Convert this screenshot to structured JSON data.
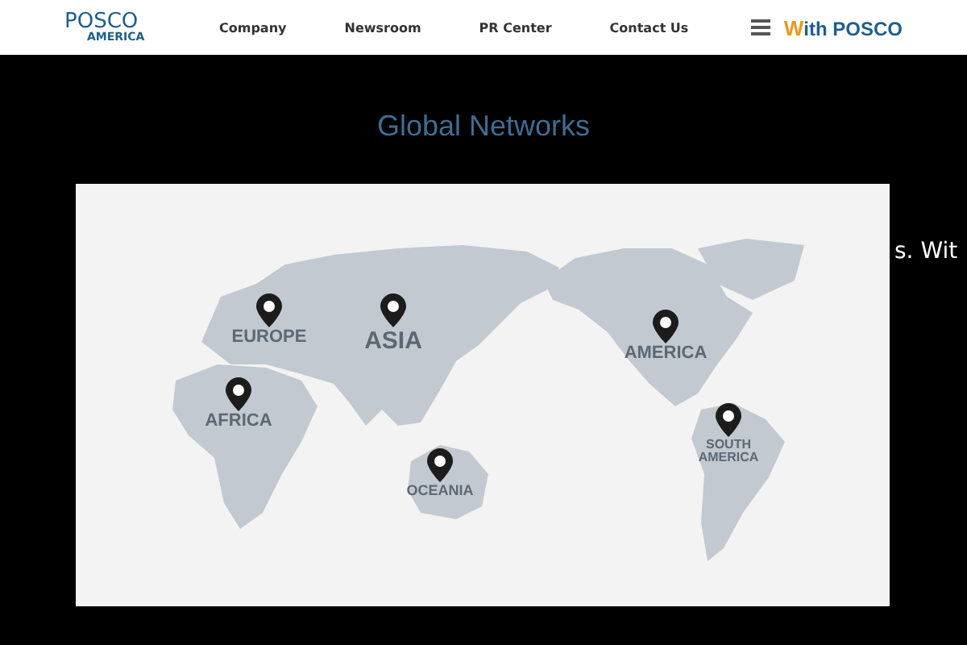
{
  "header": {
    "logo": {
      "name": "POSCO",
      "sub": "AMERICA"
    },
    "nav": [
      "Company",
      "Newsroom",
      "PR Center",
      "Contact Us"
    ],
    "brand": {
      "mark": "W",
      "text": "ith POSCO"
    }
  },
  "section": {
    "title": "Global Networks",
    "side_text": "s. Wit"
  },
  "regions": [
    {
      "label": "EUROPE",
      "kind": "medium"
    },
    {
      "label": "ASIA",
      "kind": "large"
    },
    {
      "label": "AFRICA",
      "kind": "medium"
    },
    {
      "label": "OCEANIA",
      "kind": "small"
    },
    {
      "label": "AMERICA",
      "kind": "medium"
    },
    {
      "label": "SOUTH AMERICA",
      "kind": "tiny"
    }
  ]
}
